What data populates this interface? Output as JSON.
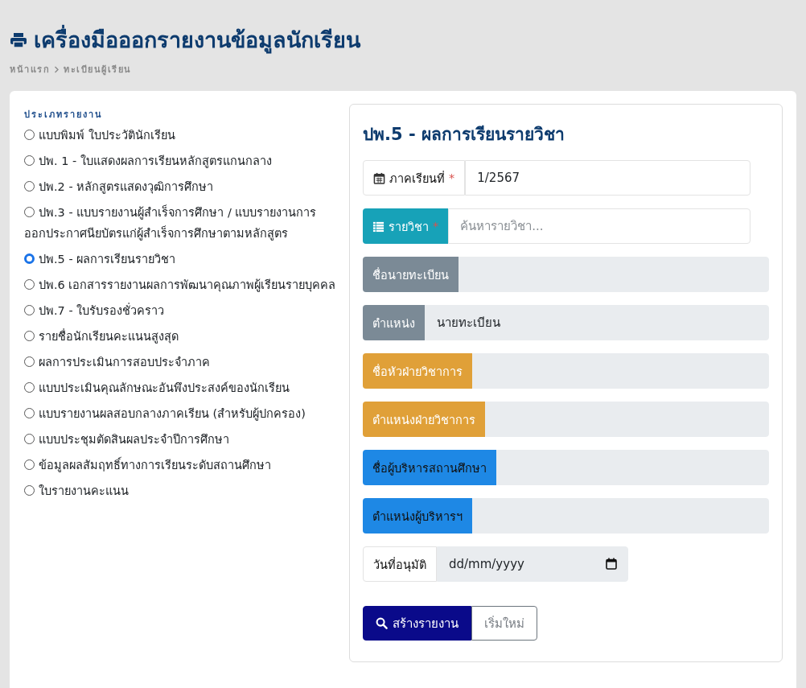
{
  "header": {
    "title": "เครื่องมือออกรายงานข้อมูลนักเรียน",
    "breadcrumb": [
      "หน้าแรก",
      "ทะเบียนผู้เรียน"
    ]
  },
  "report_types": {
    "heading": "ประเภทรายงาน",
    "options": [
      {
        "label": "แบบพิมพ์ ใบประวัตินักเรียน",
        "selected": false
      },
      {
        "label": "ปพ. 1 - ใบแสดงผลการเรียนหลักสูตรแกนกลาง",
        "selected": false
      },
      {
        "label": "ปพ.2 - หลักสูตรแสดงวุฒิการศึกษา",
        "selected": false
      },
      {
        "label": "ปพ.3 - แบบรายงานผู้สำเร็จการศึกษา / แบบรายงานการออกประกาศนียบัตรแก่ผู้สำเร็จการศึกษาตามหลักสูตร",
        "selected": false
      },
      {
        "label": "ปพ.5 - ผลการเรียนรายวิชา",
        "selected": true
      },
      {
        "label": "ปพ.6 เอกสารรายงานผลการพัฒนาคุณภาพผู้เรียนรายบุคคล",
        "selected": false
      },
      {
        "label": "ปพ.7 - ใบรับรองชั่วคราว",
        "selected": false
      },
      {
        "label": "รายชื่อนักเรียนคะแนนสูงสุด",
        "selected": false
      },
      {
        "label": "ผลการประเมินการสอบประจำภาค",
        "selected": false
      },
      {
        "label": "แบบประเมินคุณลักษณะอันพึงประสงค์ของนักเรียน",
        "selected": false
      },
      {
        "label": "แบบรายงานผลสอบกลางภาคเรียน (สำหรับผู้ปกครอง)",
        "selected": false
      },
      {
        "label": "แบบประชุมตัดสินผลประจำปีการศึกษา",
        "selected": false
      },
      {
        "label": "ข้อมูลผลสัมฤทธิ์ทางการเรียนระดับสถานศึกษา",
        "selected": false
      },
      {
        "label": "ใบรายงานคะแนน",
        "selected": false
      }
    ]
  },
  "form": {
    "title": "ปพ.5 - ผลการเรียนรายวิชา",
    "fields": [
      {
        "kind": "input",
        "label": "ภาคเรียนที่",
        "color": "#ffffff",
        "required_mark": "*",
        "value": "1/2567"
      },
      {
        "kind": "input",
        "label": "รายวิชา",
        "color": "#17a2b8",
        "required_mark": "*",
        "placeholder": "ค้นหารายวิชา..."
      },
      {
        "kind": "readonly",
        "label": "ชื่อนายทะเบียน",
        "color": "#7b8a96"
      },
      {
        "kind": "readonly",
        "label": "ตำแหน่ง",
        "color": "#7b8a96",
        "value": "นายทะเบียน"
      },
      {
        "kind": "readonly",
        "label": "ชื่อหัวฝ่ายวิชาการ",
        "color": "#e0a038"
      },
      {
        "kind": "readonly",
        "label": "ตำแหน่งฝ่ายวิชาการ",
        "color": "#e0a038"
      },
      {
        "kind": "readonly",
        "label": "ชื่อผู้บริหารสถานศึกษา",
        "color": "#1e88e5"
      },
      {
        "kind": "readonly",
        "label": "ตำแหน่งผู้บริหารฯ",
        "color": "#1e88e5"
      },
      {
        "kind": "date",
        "label": "วันที่อนุมัติ",
        "color": "#ffffff",
        "placeholder": "dd/mm/yyyy"
      }
    ],
    "buttons": [
      {
        "label": "สร้างรายงาน",
        "kind": "primary"
      },
      {
        "label": "เริ่มใหม่",
        "kind": "outline"
      }
    ]
  }
}
